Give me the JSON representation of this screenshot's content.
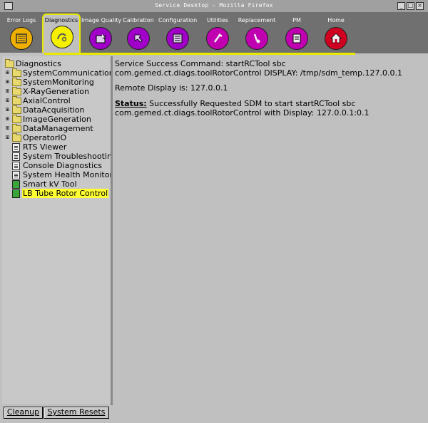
{
  "window": {
    "title": "Service Desktop - Mozilla Firefox"
  },
  "toolbar": {
    "items": [
      {
        "label": "Error Logs",
        "icon": "log-list-icon",
        "color": "#f0b000"
      },
      {
        "label": "Diagnostics",
        "icon": "diagnostics-icon",
        "color": "#f4f000",
        "active": true
      },
      {
        "label": "Image Quality",
        "icon": "image-quality-icon",
        "color": "#a000c8"
      },
      {
        "label": "Calibration",
        "icon": "calibration-icon",
        "color": "#a000c8"
      },
      {
        "label": "Configuration",
        "icon": "configuration-icon",
        "color": "#a000c8"
      },
      {
        "label": "Utilities",
        "icon": "utilities-icon",
        "color": "#c000b0"
      },
      {
        "label": "Replacement",
        "icon": "replacement-icon",
        "color": "#c000b0"
      },
      {
        "label": "PM",
        "icon": "pm-icon",
        "color": "#c000b0"
      },
      {
        "label": "Home",
        "icon": "home-icon",
        "color": "#d00020"
      }
    ]
  },
  "tree": {
    "root": "Diagnostics",
    "folders": [
      "SystemCommunications",
      "SystemMonitoring",
      "X-RayGeneration",
      "AxialControl",
      "DataAcquisition",
      "ImageGeneration",
      "DataManagement",
      "OperatorIO"
    ],
    "tools": [
      "RTS Viewer",
      "System Troubleshooting Tool",
      "Console Diagnostics",
      "System Health Monitor",
      "Smart kV Tool",
      "LB Tube Rotor Control"
    ],
    "selected": "LB Tube Rotor Control"
  },
  "bottom": {
    "cleanup": "Cleanup",
    "resets": "System Resets"
  },
  "content": {
    "command_line": "Service Success Command: startRCTool sbc com.gemed.ct.diags.toolRotorControl DISPLAY: /tmp/sdm_temp.127.0.0.1",
    "remote_display": "Remote Display is: 127.0.0.1",
    "status_label": "Status:",
    "status_text": " Successfully Requested SDM to start startRCTool sbc com.gemed.ct.diags.toolRotorControl with Display: 127.0.0.1:0.1"
  },
  "colors": {
    "highlight": "#ffff33",
    "active_tab_border": "#e8e800",
    "toolbar_bg": "#707070",
    "panel_bg": "#c0c0c0"
  }
}
